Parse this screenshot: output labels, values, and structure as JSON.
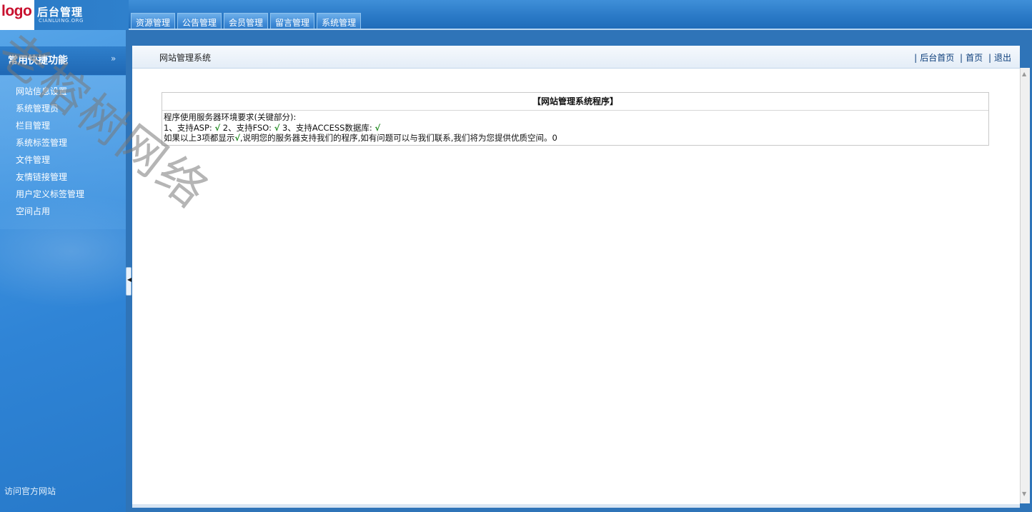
{
  "header": {
    "logo_text": "logo",
    "app_title": "后台管理",
    "app_subtitle": "CIANLUING.ORG",
    "tabs": [
      "资源管理",
      "公告管理",
      "会员管理",
      "留言管理",
      "系统管理"
    ]
  },
  "sidebar": {
    "heading": "常用快捷功能",
    "items": [
      "网站信息设置",
      "系统管理员",
      "栏目管理",
      "系统标签管理",
      "文件管理",
      "友情链接管理",
      "用户定义标签管理",
      "空间占用"
    ],
    "footer_link": "访问官方网站"
  },
  "main": {
    "title": "网站管理系统",
    "links": [
      "后台首页",
      "首页",
      "退出"
    ],
    "panel_title": "【网站管理系统程序】",
    "line1": "程序使用服务器环境要求(关键部分):",
    "line2_a": "1、支持ASP: ",
    "line2_b": " 2、支持FSO: ",
    "line2_c": " 3、支持ACCESS数据库: ",
    "check_mark": "√",
    "line3_a": "如果以上3项都显示",
    "line3_b": ",说明您的服务器支持我们的程序,如有问题可以与我们联系,我们将为您提供优质空间。0"
  },
  "watermark": "老榕树网络",
  "colors": {
    "header_blue": "#2a79c6",
    "sidebar_blue": "#3e92df",
    "link_blue": "#0b3d7a",
    "logo_red": "#c8102e",
    "check_green": "#1f8a1f"
  }
}
